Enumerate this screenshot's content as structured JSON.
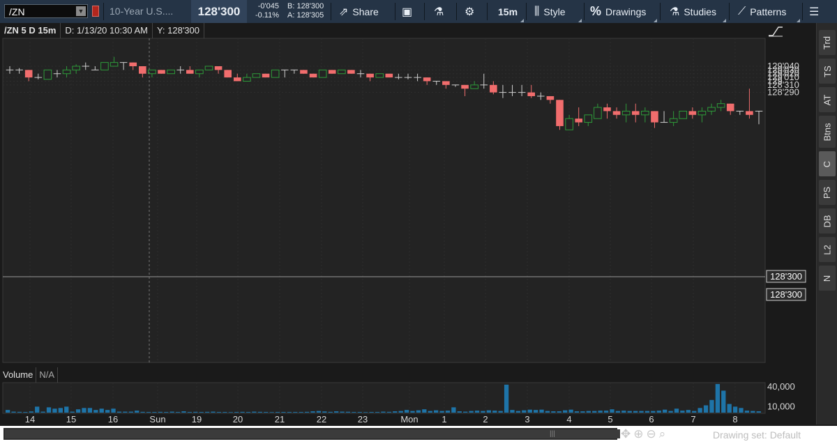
{
  "toolbar": {
    "symbol": "/ZN",
    "description": "10-Year U.S....",
    "last_price": "128'300",
    "net_change": "-0'045",
    "pct_change": "-0.11%",
    "bid": "B: 128'300",
    "ask": "A: 128'305",
    "share_label": "Share",
    "timeframe_label": "15m",
    "style_label": "Style",
    "drawings_label": "Drawings",
    "studies_label": "Studies",
    "patterns_label": "Patterns"
  },
  "chart_header": {
    "symbol_period": "/ZN 5 D 15m",
    "date_readout": "D: 1/13/20 10:30 AM",
    "y_readout": "Y: 128'300"
  },
  "price_axis": {
    "ticks": [
      "129'040",
      "129'030",
      "129'020",
      "129'010",
      "129",
      "128'310",
      "128'290"
    ],
    "crosshair_label": "128'300",
    "last_label": "128'300"
  },
  "volume_panel": {
    "label": "Volume",
    "value": "N/A",
    "ticks": [
      "40,000",
      "10,000"
    ]
  },
  "x_axis": {
    "labels": [
      "14",
      "15",
      "16",
      "Sun",
      "19",
      "20",
      "21",
      "22",
      "23",
      "Mon",
      "1",
      "2",
      "3",
      "4",
      "5",
      "6",
      "7",
      "8"
    ]
  },
  "side_tabs": [
    "Trd",
    "TS",
    "AT",
    "Btns",
    "C",
    "PS",
    "DB",
    "L2",
    "N"
  ],
  "footer": {
    "drawing_set": "Drawing set: Default"
  },
  "colors": {
    "up": "#2e9b3a",
    "down": "#f16d6d",
    "doji": "#d0d0d0",
    "volume": "#1e74a8",
    "toolbar": "#253446"
  },
  "chart_data": [
    {
      "type": "candlestick",
      "title": "/ZN 5 D 15m",
      "y_axis_ticks_in_32nds": [
        "129'040",
        "129'030",
        "129'020",
        "129'010",
        "129",
        "128'310",
        "128'300",
        "128'290"
      ],
      "ylim_ticks_from_128": [
        28.25,
        41.5
      ],
      "bars_ticks_from_128": [
        {
          "o": 35,
          "h": 36,
          "l": 34,
          "c": 35
        },
        {
          "o": 35,
          "h": 35.5,
          "l": 34,
          "c": 35
        },
        {
          "o": 35,
          "h": 35,
          "l": 32,
          "c": 33
        },
        {
          "o": 33,
          "h": 34,
          "l": 32.5,
          "c": 33
        },
        {
          "o": 32.5,
          "h": 35,
          "l": 32.5,
          "c": 35
        },
        {
          "o": 34,
          "h": 35,
          "l": 33,
          "c": 34
        },
        {
          "o": 34,
          "h": 36,
          "l": 33,
          "c": 35
        },
        {
          "o": 35,
          "h": 36.5,
          "l": 34,
          "c": 36
        },
        {
          "o": 36,
          "h": 37,
          "l": 35,
          "c": 36
        },
        {
          "o": 35,
          "h": 36,
          "l": 35,
          "c": 35
        },
        {
          "o": 35,
          "h": 37,
          "l": 35,
          "c": 37
        },
        {
          "o": 36,
          "h": 38.5,
          "l": 36,
          "c": 37
        },
        {
          "o": 37,
          "h": 37,
          "l": 35,
          "c": 37
        },
        {
          "o": 37,
          "h": 37,
          "l": 35,
          "c": 36
        },
        {
          "o": 36,
          "h": 36,
          "l": 33,
          "c": 34
        },
        {
          "o": 34,
          "h": 35,
          "l": 33,
          "c": 35
        },
        {
          "o": 35,
          "h": 35,
          "l": 34,
          "c": 34
        },
        {
          "o": 34,
          "h": 35,
          "l": 34,
          "c": 35
        },
        {
          "o": 35,
          "h": 36,
          "l": 34,
          "c": 35
        },
        {
          "o": 35,
          "h": 36,
          "l": 34,
          "c": 34
        },
        {
          "o": 34,
          "h": 35,
          "l": 33,
          "c": 35
        },
        {
          "o": 35,
          "h": 36,
          "l": 35,
          "c": 36
        },
        {
          "o": 36,
          "h": 36,
          "l": 34,
          "c": 35
        },
        {
          "o": 35,
          "h": 35,
          "l": 33,
          "c": 33
        },
        {
          "o": 33,
          "h": 34,
          "l": 32,
          "c": 32
        },
        {
          "o": 32,
          "h": 34,
          "l": 32,
          "c": 33
        },
        {
          "o": 33,
          "h": 34,
          "l": 33,
          "c": 34
        },
        {
          "o": 34,
          "h": 34,
          "l": 33,
          "c": 33
        },
        {
          "o": 33,
          "h": 35,
          "l": 33,
          "c": 35
        },
        {
          "o": 35,
          "h": 35,
          "l": 33,
          "c": 35
        },
        {
          "o": 35,
          "h": 35,
          "l": 34,
          "c": 35
        },
        {
          "o": 35,
          "h": 35,
          "l": 34,
          "c": 34
        },
        {
          "o": 34,
          "h": 34,
          "l": 33,
          "c": 33
        },
        {
          "o": 33,
          "h": 35,
          "l": 33,
          "c": 35
        },
        {
          "o": 35,
          "h": 35,
          "l": 34,
          "c": 34
        },
        {
          "o": 34,
          "h": 35,
          "l": 34,
          "c": 35
        },
        {
          "o": 35,
          "h": 35,
          "l": 34,
          "c": 34
        },
        {
          "o": 34,
          "h": 35,
          "l": 33,
          "c": 34
        },
        {
          "o": 34,
          "h": 34,
          "l": 32,
          "c": 33
        },
        {
          "o": 33,
          "h": 34,
          "l": 33,
          "c": 34
        },
        {
          "o": 34,
          "h": 34,
          "l": 33,
          "c": 33
        },
        {
          "o": 33,
          "h": 34,
          "l": 32.5,
          "c": 33
        },
        {
          "o": 33,
          "h": 34,
          "l": 32.5,
          "c": 33
        },
        {
          "o": 33,
          "h": 34,
          "l": 32,
          "c": 33
        },
        {
          "o": 33,
          "h": 33,
          "l": 31,
          "c": 32
        },
        {
          "o": 32,
          "h": 32,
          "l": 31,
          "c": 32
        },
        {
          "o": 32,
          "h": 32,
          "l": 30,
          "c": 31
        },
        {
          "o": 31,
          "h": 31,
          "l": 30.5,
          "c": 31
        },
        {
          "o": 31,
          "h": 31,
          "l": 28,
          "c": 30
        },
        {
          "o": 30,
          "h": 32,
          "l": 30,
          "c": 31
        },
        {
          "o": 31,
          "h": 34,
          "l": 30,
          "c": 31
        },
        {
          "o": 31,
          "h": 32,
          "l": 28.5,
          "c": 29
        },
        {
          "o": 29,
          "h": 31,
          "l": 27.5,
          "c": 29
        },
        {
          "o": 29,
          "h": 31,
          "l": 28,
          "c": 29
        },
        {
          "o": 29,
          "h": 31,
          "l": 28,
          "c": 29
        },
        {
          "o": 29,
          "h": 31,
          "l": 27.5,
          "c": 28
        },
        {
          "o": 28,
          "h": 29,
          "l": 27,
          "c": 28
        },
        {
          "o": 28,
          "h": 28,
          "l": 26,
          "c": 27
        },
        {
          "o": 27,
          "h": 27,
          "l": 19,
          "c": 20
        },
        {
          "o": 19,
          "h": 23,
          "l": 19,
          "c": 22
        },
        {
          "o": 22,
          "h": 25,
          "l": 20,
          "c": 21
        },
        {
          "o": 21,
          "h": 23,
          "l": 20,
          "c": 23
        },
        {
          "o": 22,
          "h": 26,
          "l": 22,
          "c": 25
        },
        {
          "o": 25,
          "h": 26,
          "l": 22,
          "c": 24
        },
        {
          "o": 24,
          "h": 25,
          "l": 22,
          "c": 23
        },
        {
          "o": 23,
          "h": 26,
          "l": 21,
          "c": 24
        },
        {
          "o": 24,
          "h": 26,
          "l": 21,
          "c": 23
        },
        {
          "o": 23,
          "h": 25,
          "l": 21,
          "c": 24
        },
        {
          "o": 24,
          "h": 24,
          "l": 19.5,
          "c": 21
        },
        {
          "o": 21,
          "h": 24,
          "l": 21,
          "c": 21
        },
        {
          "o": 21,
          "h": 24,
          "l": 20,
          "c": 22
        },
        {
          "o": 22,
          "h": 24,
          "l": 22,
          "c": 24
        },
        {
          "o": 24,
          "h": 25,
          "l": 22,
          "c": 23
        },
        {
          "o": 23,
          "h": 25,
          "l": 21,
          "c": 24
        },
        {
          "o": 24,
          "h": 26,
          "l": 23,
          "c": 25
        },
        {
          "o": 25,
          "h": 27,
          "l": 24,
          "c": 26
        },
        {
          "o": 26,
          "h": 26,
          "l": 23,
          "c": 24
        },
        {
          "o": 24,
          "h": 24,
          "l": 23,
          "c": 24
        },
        {
          "o": 24,
          "h": 30,
          "l": 22,
          "c": 23
        },
        {
          "o": 24,
          "h": 24,
          "l": 20.5,
          "c": 24
        }
      ]
    },
    {
      "type": "bar",
      "title": "Volume",
      "ylim": [
        0,
        45000
      ],
      "y_ticks": [
        10000,
        40000
      ],
      "values": [
        4000,
        1500,
        1200,
        1000,
        1800,
        9000,
        1500,
        8000,
        6000,
        7000,
        9000,
        1500,
        5000,
        7000,
        7000,
        4000,
        6000,
        4000,
        6000,
        1500,
        1500,
        1500,
        3000,
        1200,
        1000,
        1000,
        1200,
        1000,
        1500,
        1000,
        2000,
        1000,
        1200,
        1000,
        1200,
        1500,
        1000,
        1000,
        800,
        1000,
        1200,
        1000,
        1500,
        1200,
        1000,
        800,
        1000,
        1000,
        1000,
        1000,
        1000,
        1200,
        2000,
        2500,
        1800,
        1200,
        2000,
        1500,
        1300,
        1000,
        1000,
        800,
        1000,
        1000,
        1500,
        1200,
        2000,
        2500,
        4000,
        2500,
        3500,
        5000,
        2500,
        3500,
        2500,
        3000,
        8000,
        2000,
        1500,
        2500,
        3000,
        2500,
        3500,
        3000,
        2500,
        42000,
        4000,
        2500,
        3500,
        4500,
        4000,
        4500,
        2500,
        2000,
        2000,
        3500,
        4500,
        2000,
        2000,
        2500,
        2500,
        3000,
        3000,
        5000,
        2500,
        3000,
        2500,
        2500,
        2500,
        2500,
        2500,
        3000,
        4500,
        2500,
        6000,
        3000,
        4000,
        2500,
        7000,
        11000,
        19000,
        43000,
        33000,
        13000,
        9000,
        7000,
        3000,
        2500,
        2000
      ]
    }
  ]
}
